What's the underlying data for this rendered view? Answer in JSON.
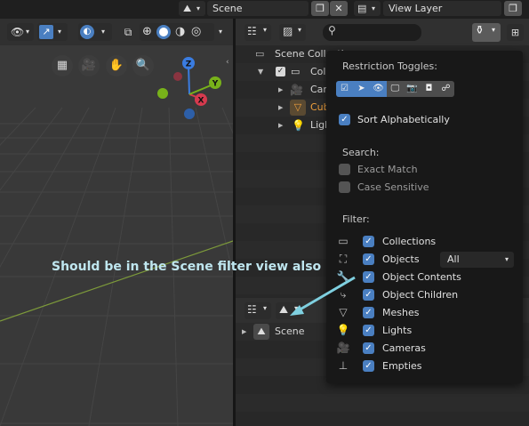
{
  "topbar": {
    "scene_name": "Scene",
    "close_label": "✕",
    "view_layer_name": "View Layer"
  },
  "outliner": {
    "search_placeholder": "",
    "rows": [
      {
        "label": "Scene Collection"
      },
      {
        "label": "Collection"
      },
      {
        "label": "Camera"
      },
      {
        "label": "Cube"
      },
      {
        "label": "Light"
      }
    ]
  },
  "popup": {
    "restriction_title": "Restriction Toggles:",
    "sort_label": "Sort Alphabetically",
    "search_title": "Search:",
    "exact_match_label": "Exact Match",
    "case_sensitive_label": "Case Sensitive",
    "filter_title": "Filter:",
    "filters": [
      {
        "label": "Collections",
        "checked": true
      },
      {
        "label": "Objects",
        "checked": true
      },
      {
        "label": "Object Contents",
        "checked": true
      },
      {
        "label": "Object Children",
        "checked": true
      },
      {
        "label": "Meshes",
        "checked": true
      },
      {
        "label": "Lights",
        "checked": true
      },
      {
        "label": "Cameras",
        "checked": true
      },
      {
        "label": "Empties",
        "checked": true
      }
    ],
    "objects_select_value": "All"
  },
  "outliner2": {
    "scene_label": "Scene"
  },
  "annotation": {
    "text": "Should be in the Scene filter view also",
    "color": "#7fd0e0"
  },
  "colors": {
    "accent": "#4a7fc1",
    "selected_object": "#f0a03c",
    "axis_x": "#d63a4e",
    "axis_y": "#78b21a",
    "axis_z": "#3a7ce0"
  }
}
